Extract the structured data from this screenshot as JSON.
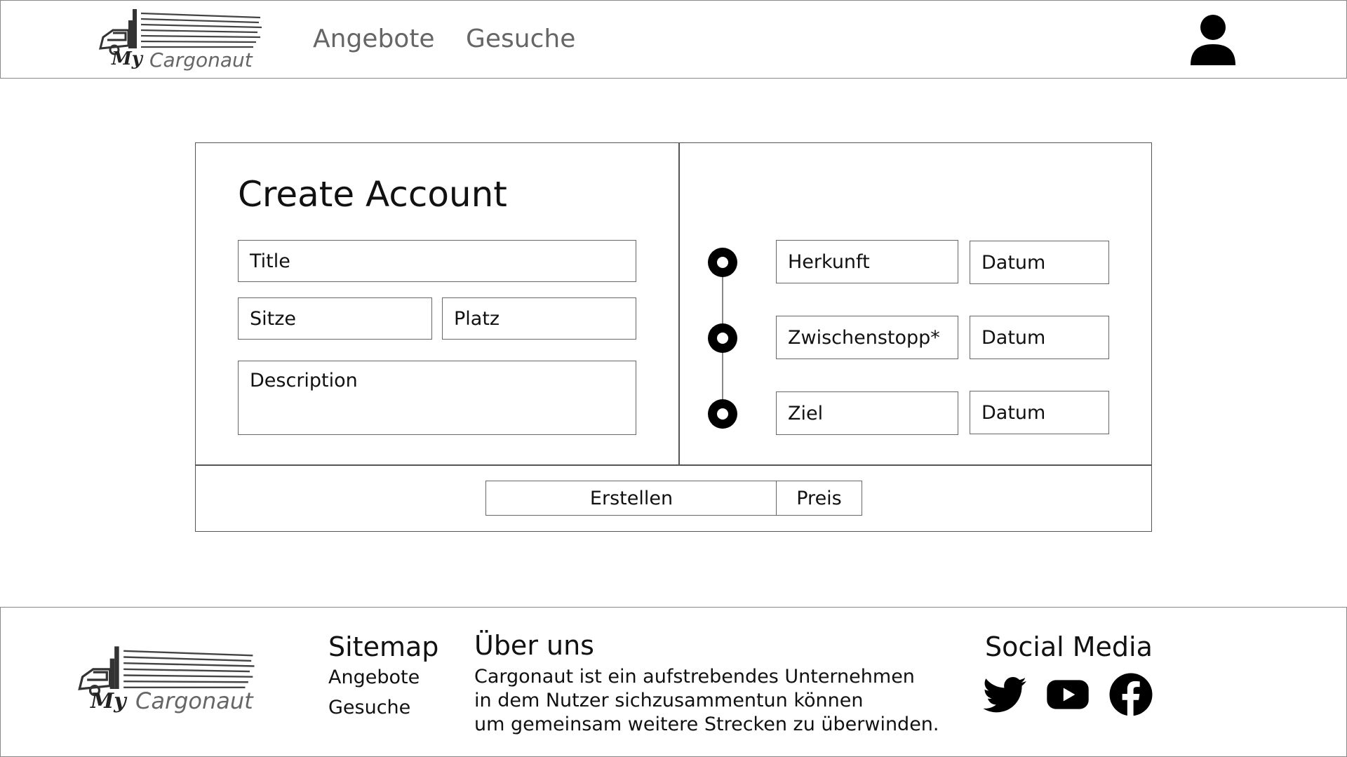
{
  "header": {
    "logo": {
      "my": "My",
      "brand": "Cargonaut"
    },
    "nav": [
      "Angebote",
      "Gesuche"
    ],
    "user_icon": "user-icon"
  },
  "form": {
    "title": "Create Account",
    "fields": {
      "title": "Title",
      "seats": "Sitze",
      "space": "Platz",
      "description": "Description"
    },
    "route": [
      {
        "place": "Herkunft",
        "date": "Datum"
      },
      {
        "place": "Zwischenstopp*",
        "date": "Datum"
      },
      {
        "place": "Ziel",
        "date": "Datum"
      }
    ],
    "submit_label": "Erstellen",
    "price_label": "Preis"
  },
  "footer": {
    "logo": {
      "my": "My",
      "brand": "Cargonaut"
    },
    "sitemap": {
      "heading": "Sitemap",
      "links": [
        "Angebote",
        "Gesuche"
      ]
    },
    "about": {
      "heading": "Über uns",
      "lines": [
        "Cargonaut ist ein aufstrebendes Unternehmen",
        "in dem Nutzer sichzusammentun können",
        "um gemeinsam weitere Strecken zu überwinden."
      ]
    },
    "social": {
      "heading": "Social Media",
      "icons": [
        "twitter-icon",
        "youtube-icon",
        "facebook-icon"
      ]
    }
  },
  "colors": {
    "border": "#555555",
    "text": "#111111",
    "nav": "#666666",
    "accent": "#000000"
  }
}
